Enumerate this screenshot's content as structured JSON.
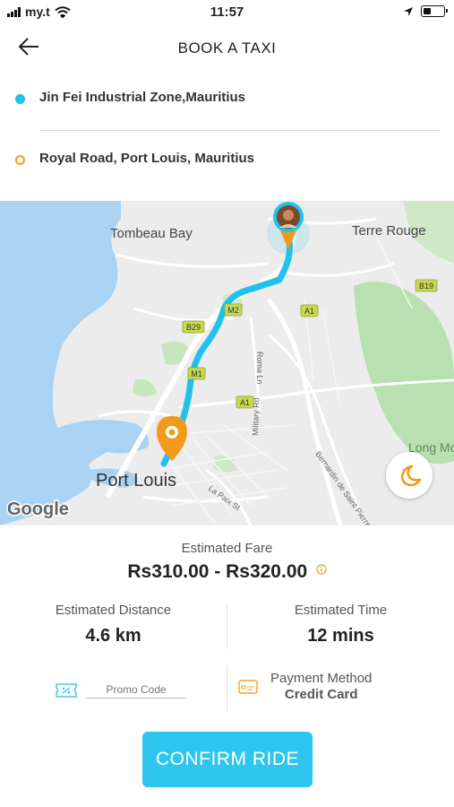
{
  "status_bar": {
    "carrier": "my.t",
    "time": "11:57"
  },
  "header": {
    "title": "BOOK A TAXI"
  },
  "pickup": {
    "address": "Jin Fei Industrial Zone,Mauritius",
    "color": "#21c1ec"
  },
  "dropoff": {
    "address": "Royal Road, Port Louis, Mauritius",
    "color": "#f29a1c"
  },
  "map": {
    "labels": {
      "tombeau_bay": "Tombeau Bay",
      "terre_rouge": "Terre Rouge",
      "port_louis": "Port Louis",
      "long_mountain": "Long Mountain",
      "roma_ln": "Roma Ln",
      "military_rd": "Military Rd",
      "la_paix_st": "La Paix St",
      "bernardin": "Bernardin de Saint Pierre",
      "google": "Google"
    },
    "shields": {
      "m2": "M2",
      "m1": "M1",
      "a1_top": "A1",
      "a1_mid": "A1",
      "b29": "B29",
      "b19": "B19"
    },
    "route_color": "#21c1ec",
    "water_color": "#a9d2f3",
    "park_color": "#b9e0b0"
  },
  "fare": {
    "label": "Estimated Fare",
    "value": "Rs310.00 - Rs320.00"
  },
  "distance": {
    "label": "Estimated Distance",
    "value": "4.6 km"
  },
  "time": {
    "label": "Estimated Time",
    "value": "12 mins"
  },
  "promo": {
    "placeholder": "Promo Code"
  },
  "payment": {
    "label": "Payment Method",
    "value": "Credit Card"
  },
  "confirm_button": {
    "label": "CONFIRM RIDE",
    "color": "#2ec6ee"
  },
  "icons": {
    "back": "arrow-left-icon",
    "wifi": "wifi-icon",
    "location": "location-arrow-icon",
    "battery": "battery-icon",
    "info": "info-icon",
    "promo": "ticket-icon",
    "payment": "card-icon",
    "night_mode": "moon-icon",
    "pickup_marker": "driver-avatar-marker",
    "dropoff_marker": "dropoff-pin-icon"
  }
}
